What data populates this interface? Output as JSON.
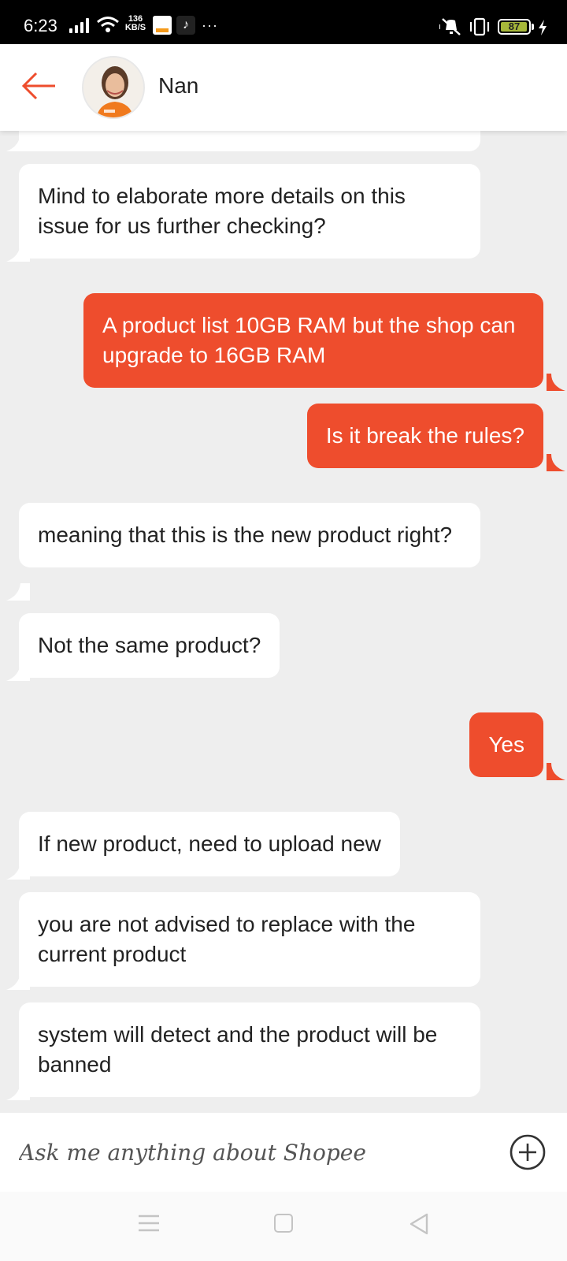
{
  "status_bar": {
    "time": "6:23",
    "net_speed_value": "136",
    "net_speed_unit": "KB/S",
    "battery_level": "87",
    "icons": [
      "signal-icon",
      "wifi-icon",
      "app-notification-icon",
      "tiktok-icon",
      "more-icon",
      "mute-icon",
      "vibrate-icon",
      "battery-icon",
      "charging-icon"
    ]
  },
  "header": {
    "back_icon": "arrow-left-icon",
    "contact_name": "Nan"
  },
  "messages": [
    {
      "from": "agent",
      "text": "Mind to elaborate more details on this issue for us further checking?"
    },
    {
      "from": "user",
      "text": "A product list 10GB RAM but the shop can upgrade to 16GB RAM"
    },
    {
      "from": "user",
      "text": "Is it break the rules?"
    },
    {
      "from": "agent",
      "text": "meaning that this is the new product right?"
    },
    {
      "from": "agent",
      "text": "Not the same product?"
    },
    {
      "from": "user",
      "text": "Yes"
    },
    {
      "from": "agent",
      "text": "If new product, need to upload new"
    },
    {
      "from": "agent",
      "text": "you are not advised to replace with the current product"
    },
    {
      "from": "agent",
      "text": "system will detect and the product will be banned"
    }
  ],
  "input": {
    "placeholder": "Ask me anything about Shopee",
    "value": "",
    "add_icon": "plus-circle-icon"
  },
  "nav_bar": {
    "icons": [
      "menu-icon",
      "home-icon",
      "back-icon"
    ]
  },
  "colors": {
    "accent": "#ee4d2d",
    "background": "#eeeeee",
    "incoming_bubble": "#ffffff"
  }
}
